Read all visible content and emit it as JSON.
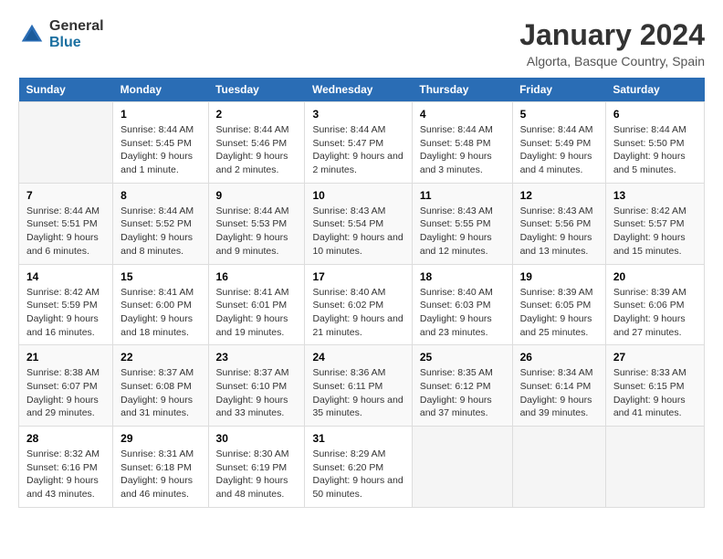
{
  "header": {
    "logo_general": "General",
    "logo_blue": "Blue",
    "title": "January 2024",
    "subtitle": "Algorta, Basque Country, Spain"
  },
  "days_of_week": [
    "Sunday",
    "Monday",
    "Tuesday",
    "Wednesday",
    "Thursday",
    "Friday",
    "Saturday"
  ],
  "weeks": [
    [
      {
        "day": "",
        "sunrise": "",
        "sunset": "",
        "daylight": ""
      },
      {
        "day": "1",
        "sunrise": "Sunrise: 8:44 AM",
        "sunset": "Sunset: 5:45 PM",
        "daylight": "Daylight: 9 hours and 1 minute."
      },
      {
        "day": "2",
        "sunrise": "Sunrise: 8:44 AM",
        "sunset": "Sunset: 5:46 PM",
        "daylight": "Daylight: 9 hours and 2 minutes."
      },
      {
        "day": "3",
        "sunrise": "Sunrise: 8:44 AM",
        "sunset": "Sunset: 5:47 PM",
        "daylight": "Daylight: 9 hours and 2 minutes."
      },
      {
        "day": "4",
        "sunrise": "Sunrise: 8:44 AM",
        "sunset": "Sunset: 5:48 PM",
        "daylight": "Daylight: 9 hours and 3 minutes."
      },
      {
        "day": "5",
        "sunrise": "Sunrise: 8:44 AM",
        "sunset": "Sunset: 5:49 PM",
        "daylight": "Daylight: 9 hours and 4 minutes."
      },
      {
        "day": "6",
        "sunrise": "Sunrise: 8:44 AM",
        "sunset": "Sunset: 5:50 PM",
        "daylight": "Daylight: 9 hours and 5 minutes."
      }
    ],
    [
      {
        "day": "7",
        "sunrise": "Sunrise: 8:44 AM",
        "sunset": "Sunset: 5:51 PM",
        "daylight": "Daylight: 9 hours and 6 minutes."
      },
      {
        "day": "8",
        "sunrise": "Sunrise: 8:44 AM",
        "sunset": "Sunset: 5:52 PM",
        "daylight": "Daylight: 9 hours and 8 minutes."
      },
      {
        "day": "9",
        "sunrise": "Sunrise: 8:44 AM",
        "sunset": "Sunset: 5:53 PM",
        "daylight": "Daylight: 9 hours and 9 minutes."
      },
      {
        "day": "10",
        "sunrise": "Sunrise: 8:43 AM",
        "sunset": "Sunset: 5:54 PM",
        "daylight": "Daylight: 9 hours and 10 minutes."
      },
      {
        "day": "11",
        "sunrise": "Sunrise: 8:43 AM",
        "sunset": "Sunset: 5:55 PM",
        "daylight": "Daylight: 9 hours and 12 minutes."
      },
      {
        "day": "12",
        "sunrise": "Sunrise: 8:43 AM",
        "sunset": "Sunset: 5:56 PM",
        "daylight": "Daylight: 9 hours and 13 minutes."
      },
      {
        "day": "13",
        "sunrise": "Sunrise: 8:42 AM",
        "sunset": "Sunset: 5:57 PM",
        "daylight": "Daylight: 9 hours and 15 minutes."
      }
    ],
    [
      {
        "day": "14",
        "sunrise": "Sunrise: 8:42 AM",
        "sunset": "Sunset: 5:59 PM",
        "daylight": "Daylight: 9 hours and 16 minutes."
      },
      {
        "day": "15",
        "sunrise": "Sunrise: 8:41 AM",
        "sunset": "Sunset: 6:00 PM",
        "daylight": "Daylight: 9 hours and 18 minutes."
      },
      {
        "day": "16",
        "sunrise": "Sunrise: 8:41 AM",
        "sunset": "Sunset: 6:01 PM",
        "daylight": "Daylight: 9 hours and 19 minutes."
      },
      {
        "day": "17",
        "sunrise": "Sunrise: 8:40 AM",
        "sunset": "Sunset: 6:02 PM",
        "daylight": "Daylight: 9 hours and 21 minutes."
      },
      {
        "day": "18",
        "sunrise": "Sunrise: 8:40 AM",
        "sunset": "Sunset: 6:03 PM",
        "daylight": "Daylight: 9 hours and 23 minutes."
      },
      {
        "day": "19",
        "sunrise": "Sunrise: 8:39 AM",
        "sunset": "Sunset: 6:05 PM",
        "daylight": "Daylight: 9 hours and 25 minutes."
      },
      {
        "day": "20",
        "sunrise": "Sunrise: 8:39 AM",
        "sunset": "Sunset: 6:06 PM",
        "daylight": "Daylight: 9 hours and 27 minutes."
      }
    ],
    [
      {
        "day": "21",
        "sunrise": "Sunrise: 8:38 AM",
        "sunset": "Sunset: 6:07 PM",
        "daylight": "Daylight: 9 hours and 29 minutes."
      },
      {
        "day": "22",
        "sunrise": "Sunrise: 8:37 AM",
        "sunset": "Sunset: 6:08 PM",
        "daylight": "Daylight: 9 hours and 31 minutes."
      },
      {
        "day": "23",
        "sunrise": "Sunrise: 8:37 AM",
        "sunset": "Sunset: 6:10 PM",
        "daylight": "Daylight: 9 hours and 33 minutes."
      },
      {
        "day": "24",
        "sunrise": "Sunrise: 8:36 AM",
        "sunset": "Sunset: 6:11 PM",
        "daylight": "Daylight: 9 hours and 35 minutes."
      },
      {
        "day": "25",
        "sunrise": "Sunrise: 8:35 AM",
        "sunset": "Sunset: 6:12 PM",
        "daylight": "Daylight: 9 hours and 37 minutes."
      },
      {
        "day": "26",
        "sunrise": "Sunrise: 8:34 AM",
        "sunset": "Sunset: 6:14 PM",
        "daylight": "Daylight: 9 hours and 39 minutes."
      },
      {
        "day": "27",
        "sunrise": "Sunrise: 8:33 AM",
        "sunset": "Sunset: 6:15 PM",
        "daylight": "Daylight: 9 hours and 41 minutes."
      }
    ],
    [
      {
        "day": "28",
        "sunrise": "Sunrise: 8:32 AM",
        "sunset": "Sunset: 6:16 PM",
        "daylight": "Daylight: 9 hours and 43 minutes."
      },
      {
        "day": "29",
        "sunrise": "Sunrise: 8:31 AM",
        "sunset": "Sunset: 6:18 PM",
        "daylight": "Daylight: 9 hours and 46 minutes."
      },
      {
        "day": "30",
        "sunrise": "Sunrise: 8:30 AM",
        "sunset": "Sunset: 6:19 PM",
        "daylight": "Daylight: 9 hours and 48 minutes."
      },
      {
        "day": "31",
        "sunrise": "Sunrise: 8:29 AM",
        "sunset": "Sunset: 6:20 PM",
        "daylight": "Daylight: 9 hours and 50 minutes."
      },
      {
        "day": "",
        "sunrise": "",
        "sunset": "",
        "daylight": ""
      },
      {
        "day": "",
        "sunrise": "",
        "sunset": "",
        "daylight": ""
      },
      {
        "day": "",
        "sunrise": "",
        "sunset": "",
        "daylight": ""
      }
    ]
  ]
}
